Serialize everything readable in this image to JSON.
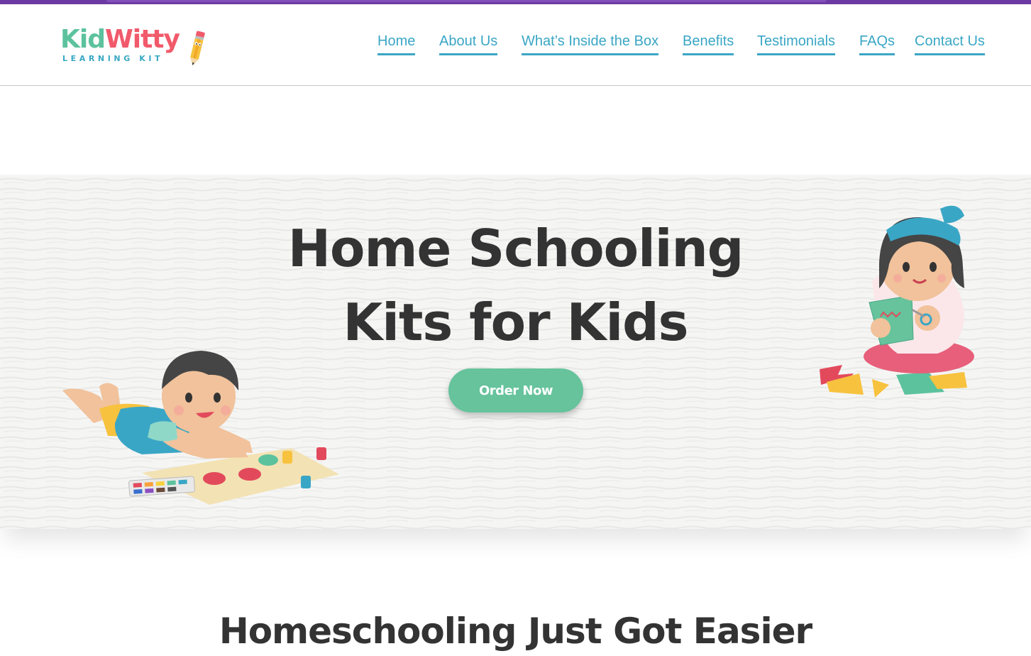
{
  "brand": {
    "logo_kid": "Kid",
    "logo_witty": "Witty",
    "logo_subtitle": "LEARNING KIT"
  },
  "nav": {
    "items": [
      {
        "label": "Home"
      },
      {
        "label": "About Us"
      },
      {
        "label": "What’s Inside the Box"
      },
      {
        "label": "Benefits"
      },
      {
        "label": "Testimonials"
      },
      {
        "label": "FAQs"
      },
      {
        "label": "Contact Us"
      }
    ]
  },
  "hero": {
    "title_line1": "Home Schooling",
    "title_line2": "Kits for Kids",
    "cta_label": "Order Now"
  },
  "section": {
    "heading": "Homeschooling Just Got Easier"
  },
  "colors": {
    "nav_link": "#3aa6c5",
    "cta": "#66c39c",
    "heading": "#333333",
    "top_bar": "#6d3aa4",
    "logo_green": "#5cc29e",
    "logo_red": "#f15a6b"
  },
  "icons": [
    "pencil-icon"
  ]
}
